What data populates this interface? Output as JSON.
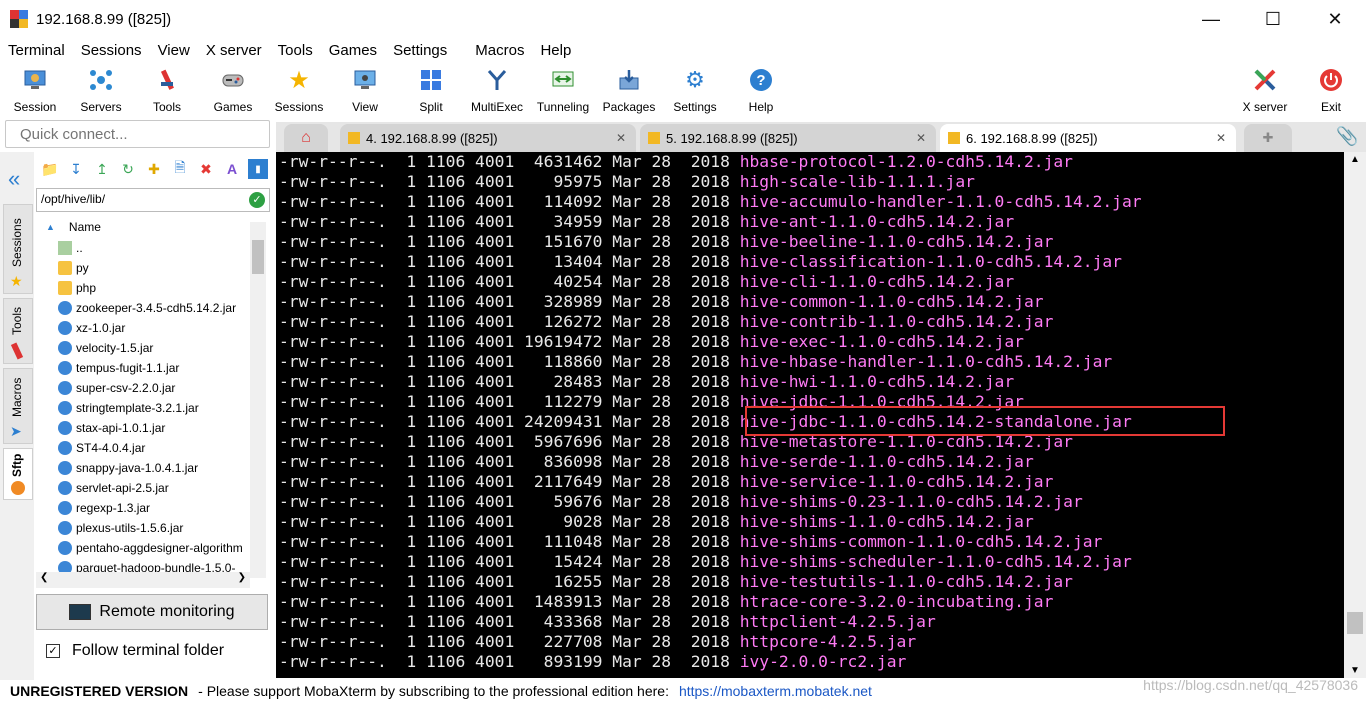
{
  "window": {
    "title": "192.168.8.99 ([825])"
  },
  "menu": [
    "Terminal",
    "Sessions",
    "View",
    "X server",
    "Tools",
    "Games",
    "Settings",
    "Macros",
    "Help"
  ],
  "toolbar": [
    {
      "label": "Session",
      "icon": "session-icon"
    },
    {
      "label": "Servers",
      "icon": "servers-icon"
    },
    {
      "label": "Tools",
      "icon": "tools-icon"
    },
    {
      "label": "Games",
      "icon": "games-icon"
    },
    {
      "label": "Sessions",
      "icon": "star-icon"
    },
    {
      "label": "View",
      "icon": "view-icon"
    },
    {
      "label": "Split",
      "icon": "split-icon"
    },
    {
      "label": "MultiExec",
      "icon": "multiexec-icon"
    },
    {
      "label": "Tunneling",
      "icon": "tunneling-icon"
    },
    {
      "label": "Packages",
      "icon": "packages-icon"
    },
    {
      "label": "Settings",
      "icon": "settings-icon"
    },
    {
      "label": "Help",
      "icon": "help-icon"
    }
  ],
  "toolbar_right": {
    "xserver": "X server",
    "exit": "Exit"
  },
  "quick_connect": {
    "placeholder": "Quick connect..."
  },
  "tabs": [
    {
      "label": "4. 192.168.8.99 ([825])",
      "active": false
    },
    {
      "label": "5. 192.168.8.99 ([825])",
      "active": false
    },
    {
      "label": "6. 192.168.8.99 ([825])",
      "active": true
    }
  ],
  "side_tabs": [
    "Sessions",
    "Tools",
    "Macros",
    "Sftp"
  ],
  "sftp": {
    "path": "/opt/hive/lib/",
    "column": "Name",
    "files": [
      {
        "name": "..",
        "type": "up"
      },
      {
        "name": "py",
        "type": "folder"
      },
      {
        "name": "php",
        "type": "folder"
      },
      {
        "name": "zookeeper-3.4.5-cdh5.14.2.jar",
        "type": "jar"
      },
      {
        "name": "xz-1.0.jar",
        "type": "jar"
      },
      {
        "name": "velocity-1.5.jar",
        "type": "jar"
      },
      {
        "name": "tempus-fugit-1.1.jar",
        "type": "jar"
      },
      {
        "name": "super-csv-2.2.0.jar",
        "type": "jar"
      },
      {
        "name": "stringtemplate-3.2.1.jar",
        "type": "jar"
      },
      {
        "name": "stax-api-1.0.1.jar",
        "type": "jar"
      },
      {
        "name": "ST4-4.0.4.jar",
        "type": "jar"
      },
      {
        "name": "snappy-java-1.0.4.1.jar",
        "type": "jar"
      },
      {
        "name": "servlet-api-2.5.jar",
        "type": "jar"
      },
      {
        "name": "regexp-1.3.jar",
        "type": "jar"
      },
      {
        "name": "plexus-utils-1.5.6.jar",
        "type": "jar"
      },
      {
        "name": "pentaho-aggdesigner-algorithm",
        "type": "jar"
      },
      {
        "name": "parquet-hadoop-bundle-1.5.0-",
        "type": "jar"
      }
    ],
    "remote_monitoring": "Remote monitoring",
    "follow_label": "Follow terminal folder",
    "follow_checked": true
  },
  "terminal": {
    "perm": "-rw-r--r--.",
    "links": "1",
    "owner": "1106",
    "group": "4001",
    "month": "Mar",
    "day": "28",
    "year": "2018",
    "files": [
      {
        "size": "4631462",
        "name": "hbase-protocol-1.2.0-cdh5.14.2.jar"
      },
      {
        "size": "95975",
        "name": "high-scale-lib-1.1.1.jar"
      },
      {
        "size": "114092",
        "name": "hive-accumulo-handler-1.1.0-cdh5.14.2.jar"
      },
      {
        "size": "34959",
        "name": "hive-ant-1.1.0-cdh5.14.2.jar"
      },
      {
        "size": "151670",
        "name": "hive-beeline-1.1.0-cdh5.14.2.jar"
      },
      {
        "size": "13404",
        "name": "hive-classification-1.1.0-cdh5.14.2.jar"
      },
      {
        "size": "40254",
        "name": "hive-cli-1.1.0-cdh5.14.2.jar"
      },
      {
        "size": "328989",
        "name": "hive-common-1.1.0-cdh5.14.2.jar"
      },
      {
        "size": "126272",
        "name": "hive-contrib-1.1.0-cdh5.14.2.jar"
      },
      {
        "size": "19619472",
        "name": "hive-exec-1.1.0-cdh5.14.2.jar"
      },
      {
        "size": "118860",
        "name": "hive-hbase-handler-1.1.0-cdh5.14.2.jar"
      },
      {
        "size": "28483",
        "name": "hive-hwi-1.1.0-cdh5.14.2.jar"
      },
      {
        "size": "112279",
        "name": "hive-jdbc-1.1.0-cdh5.14.2.jar"
      },
      {
        "size": "24209431",
        "name": "hive-jdbc-1.1.0-cdh5.14.2-standalone.jar"
      },
      {
        "size": "5967696",
        "name": "hive-metastore-1.1.0-cdh5.14.2.jar"
      },
      {
        "size": "836098",
        "name": "hive-serde-1.1.0-cdh5.14.2.jar"
      },
      {
        "size": "2117649",
        "name": "hive-service-1.1.0-cdh5.14.2.jar"
      },
      {
        "size": "59676",
        "name": "hive-shims-0.23-1.1.0-cdh5.14.2.jar"
      },
      {
        "size": "9028",
        "name": "hive-shims-1.1.0-cdh5.14.2.jar"
      },
      {
        "size": "111048",
        "name": "hive-shims-common-1.1.0-cdh5.14.2.jar"
      },
      {
        "size": "15424",
        "name": "hive-shims-scheduler-1.1.0-cdh5.14.2.jar"
      },
      {
        "size": "16255",
        "name": "hive-testutils-1.1.0-cdh5.14.2.jar"
      },
      {
        "size": "1483913",
        "name": "htrace-core-3.2.0-incubating.jar"
      },
      {
        "size": "433368",
        "name": "httpclient-4.2.5.jar"
      },
      {
        "size": "227708",
        "name": "httpcore-4.2.5.jar"
      },
      {
        "size": "893199",
        "name": "ivy-2.0.0-rc2.jar"
      }
    ],
    "highlighted_index": 13,
    "highlight_color": "#e53935",
    "filename_color": "#ff7bf5"
  },
  "status": {
    "unregistered": "UNREGISTERED VERSION",
    "message": "-  Please support MobaXterm by subscribing to the professional edition here:",
    "link": "https://mobaxterm.mobatek.net",
    "watermark": "https://blog.csdn.net/qq_42578036"
  }
}
